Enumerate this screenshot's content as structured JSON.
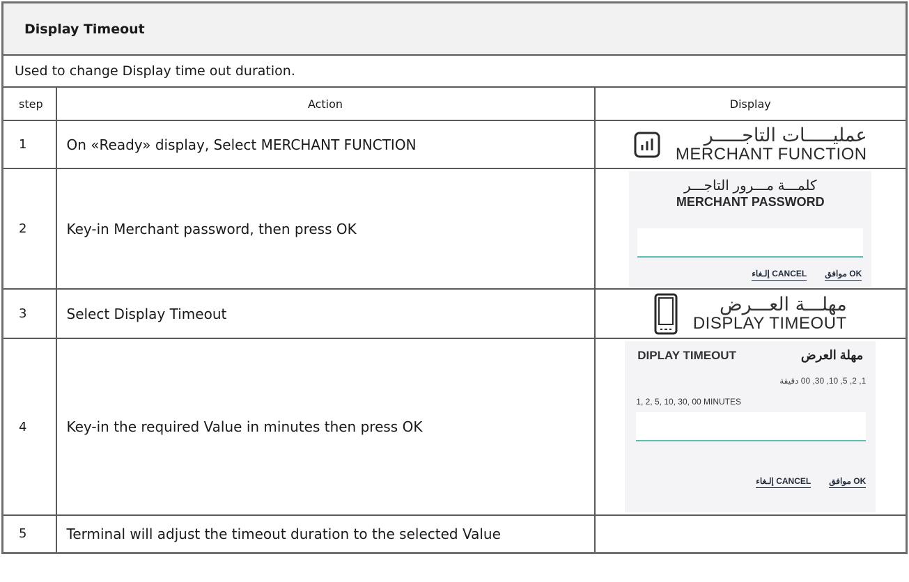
{
  "section": {
    "title": "Display Timeout",
    "description": "Used to change Display time out duration."
  },
  "table": {
    "headers": {
      "step": "step",
      "action": "Action",
      "display": "Display"
    },
    "rows": [
      {
        "step": "1",
        "action": "On «Ready» display, Select MERCHANT FUNCTION"
      },
      {
        "step": "2",
        "action": "Key-in Merchant password, then press OK"
      },
      {
        "step": "3",
        "action": "Select Display Timeout"
      },
      {
        "step": "4",
        "action": "Key-in the required Value in minutes then press OK"
      },
      {
        "step": "5",
        "action": "Terminal will adjust the timeout duration to the selected Value"
      }
    ]
  },
  "screens": {
    "merchant_function": {
      "arabic": "عمليـــــات التاجـــــر",
      "english": "MERCHANT FUNCTION",
      "icon": "bar-chart-icon"
    },
    "merchant_password": {
      "arabic": "كلمـــة مـــرور التاجـــر",
      "english": "MERCHANT PASSWORD",
      "ok_label": "موافق OK",
      "cancel_label": "إلـغاء CANCEL"
    },
    "display_timeout_menu": {
      "arabic": "مهلـــة العـــرض",
      "english": "DISPLAY TIMEOUT",
      "icon": "mobile-device-icon"
    },
    "display_timeout_entry": {
      "english_title": "DIPLAY TIMEOUT",
      "arabic_title": "مهلة العرض",
      "options_arabic": "1, 2, 5, 10, 30, 00 دقيقة",
      "options_english": "1, 2, 5, 10, 30, 00 MINUTES",
      "ok_label": "موافق OK",
      "cancel_label": "إلـغاء CANCEL"
    }
  },
  "colors": {
    "title_bg": "#f2f2f2",
    "screen_bg": "#f4f4f6",
    "input_underline": "#5bbfae",
    "border": "#5a5a5a"
  }
}
